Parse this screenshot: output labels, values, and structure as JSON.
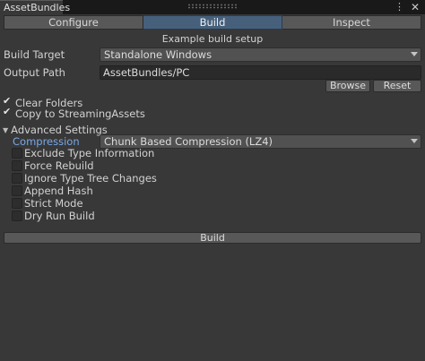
{
  "window": {
    "tab_title": "AssetBundles",
    "menu_glyph": "⋮",
    "close_glyph": "✕"
  },
  "toolbar": {
    "tabs": [
      {
        "label": "Configure",
        "active": false
      },
      {
        "label": "Build",
        "active": true
      },
      {
        "label": "Inspect",
        "active": false
      }
    ]
  },
  "subtitle": "Example build setup",
  "build_target": {
    "label": "Build Target",
    "value": "Standalone Windows"
  },
  "output_path": {
    "label": "Output Path",
    "value": "AssetBundles/PC",
    "browse": "Browse",
    "reset": "Reset"
  },
  "options": {
    "clear_folders": {
      "label": "Clear Folders",
      "checked": true
    },
    "copy_streaming": {
      "label": "Copy to StreamingAssets",
      "checked": true
    }
  },
  "advanced": {
    "label": "Advanced Settings",
    "compression": {
      "label": "Compression",
      "value": "Chunk Based Compression (LZ4)"
    },
    "flags": [
      {
        "label": "Exclude Type Information",
        "checked": false
      },
      {
        "label": "Force Rebuild",
        "checked": false
      },
      {
        "label": "Ignore Type Tree Changes",
        "checked": false
      },
      {
        "label": "Append Hash",
        "checked": false
      },
      {
        "label": "Strict Mode",
        "checked": false
      },
      {
        "label": "Dry Run Build",
        "checked": false
      }
    ]
  },
  "build_button": "Build",
  "colors": {
    "background": "#383838",
    "accent_tab": "#46607c",
    "accent_label": "#7aa8e6",
    "field": "#2a2a2a"
  },
  "glyphs": {
    "tick": "✔",
    "foldout": "▼"
  }
}
